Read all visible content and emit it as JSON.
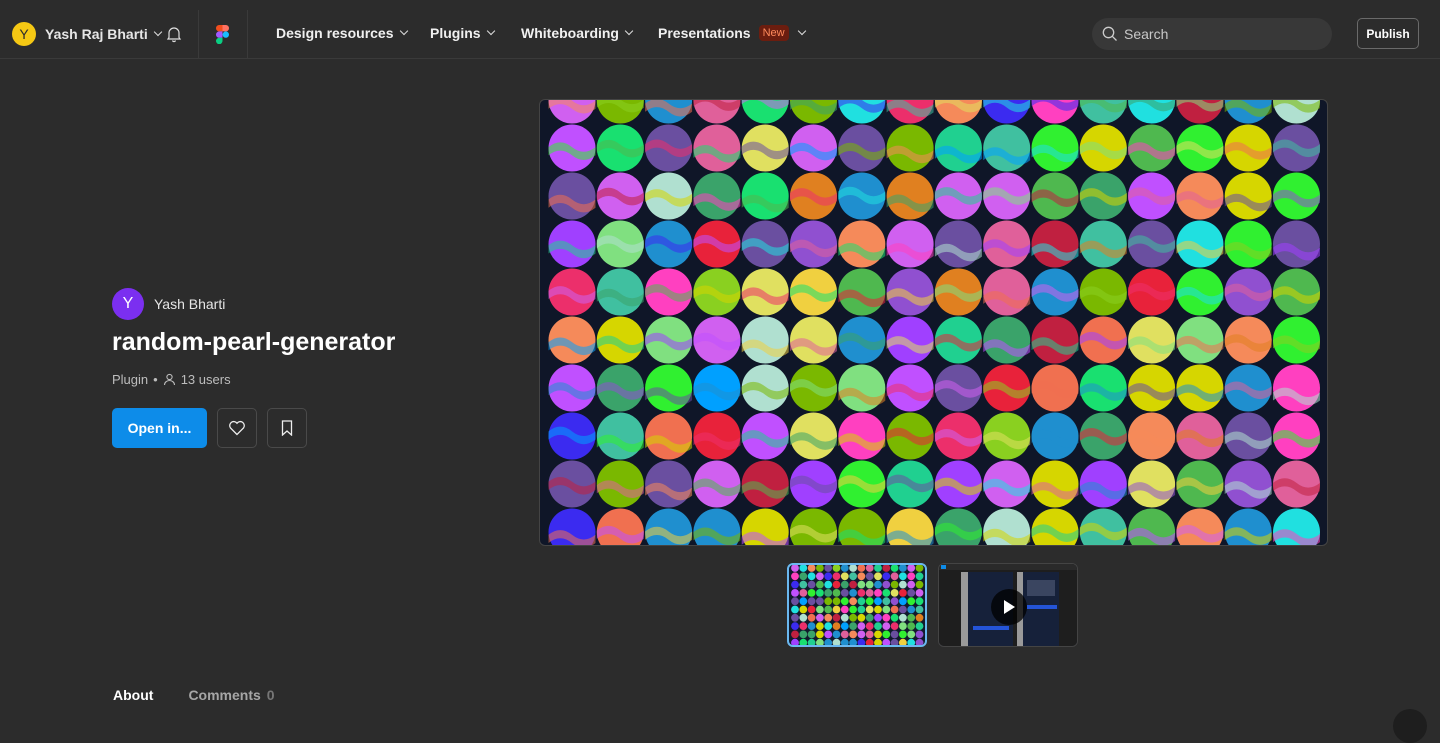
{
  "topbar": {
    "user_initial": "Y",
    "user_name": "Yash Raj Bharti",
    "nav": [
      {
        "label": "Design resources"
      },
      {
        "label": "Plugins"
      },
      {
        "label": "Whiteboarding"
      },
      {
        "label": "Presentations",
        "badge": "New"
      }
    ],
    "search_placeholder": "Search",
    "publish_label": "Publish"
  },
  "resource": {
    "author_initial": "Y",
    "author_name": "Yash Bharti",
    "title": "random-pearl-generator",
    "type": "Plugin",
    "separator": "•",
    "users": "13 users",
    "open_label": "Open in..."
  },
  "tabs": {
    "about": "About",
    "comments": "Comments",
    "comments_count": "0"
  },
  "colors": {
    "accent": "#0d8ce9",
    "badge_bg": "#6b1d0f",
    "badge_text": "#ff8a5c",
    "avatar_user": "#f5c814",
    "avatar_author": "#7b2ff0"
  }
}
